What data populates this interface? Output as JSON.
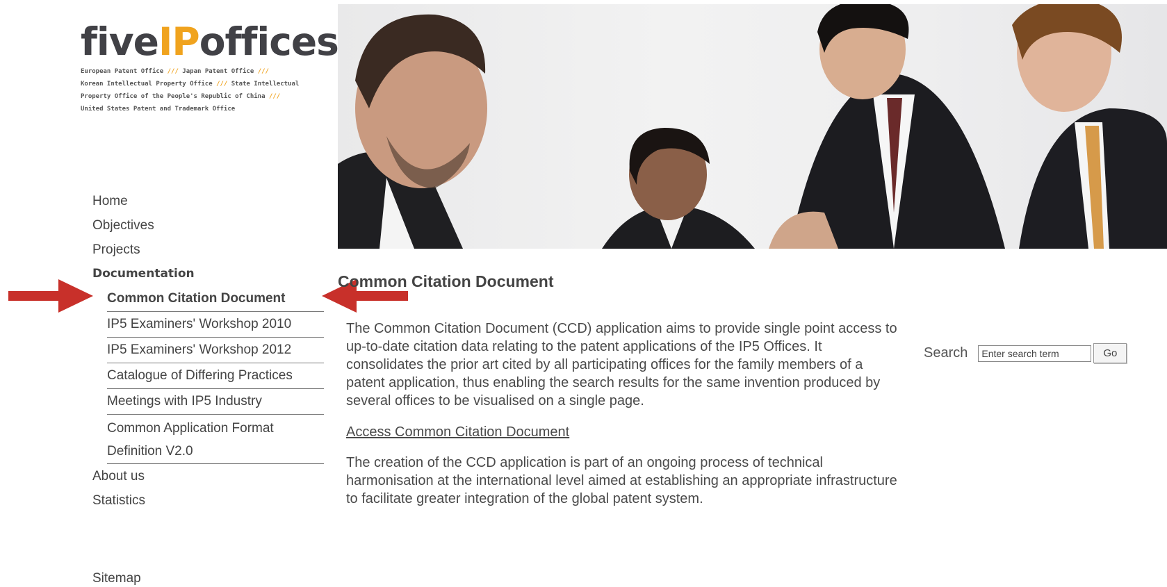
{
  "logo": {
    "word_five": "five",
    "word_ip": "IP",
    "word_offices": "offices",
    "tagline_lines": [
      {
        "text": "European Patent Office ",
        "sep": "///",
        "rest": " Japan Patent Office ",
        "sep2": "///"
      },
      {
        "text": "Korean Intellectual Property Office ",
        "sep": "///",
        "rest": " State Intellectual",
        "sep2": ""
      },
      {
        "text": "Property Office of the People's Republic of China ",
        "sep": "///",
        "rest": "",
        "sep2": ""
      },
      {
        "text": "United States Patent and Trademark Office",
        "sep": "",
        "rest": "",
        "sep2": ""
      }
    ]
  },
  "nav": {
    "items_before": [
      "Home",
      "Objectives",
      "Projects"
    ],
    "section": "Documentation",
    "subitems": [
      "Common Citation Document",
      "IP5 Examiners' Workshop 2010",
      "IP5 Examiners' Workshop 2012",
      "Catalogue of Differing Practices",
      "Meetings with IP5 Industry",
      "Common Application Format Definition V2.0"
    ],
    "items_after": [
      "About us",
      "Statistics"
    ],
    "sitemap": "Sitemap"
  },
  "main": {
    "title": "Common Citation Document",
    "paragraph1": "The Common Citation Document (CCD) application aims to provide single point access to up-to-date citation data relating to the patent applications of the IP5 Offices. It consolidates the prior art cited by all participating offices for the family members of a patent application, thus enabling the search results for the same invention produced by several offices to be visualised on a single page.",
    "link": "Access Common Citation Document",
    "paragraph2": "The creation of the CCD application is part of an ongoing process of technical harmonisation at the international level aimed at establishing an appropriate infrastructure to facilitate greater integration of the global patent system."
  },
  "search": {
    "label": "Search",
    "placeholder": "Enter search term",
    "button": "Go"
  },
  "colors": {
    "accent": "#f0a31e",
    "arrow": "#c8302a",
    "text": "#444444"
  }
}
